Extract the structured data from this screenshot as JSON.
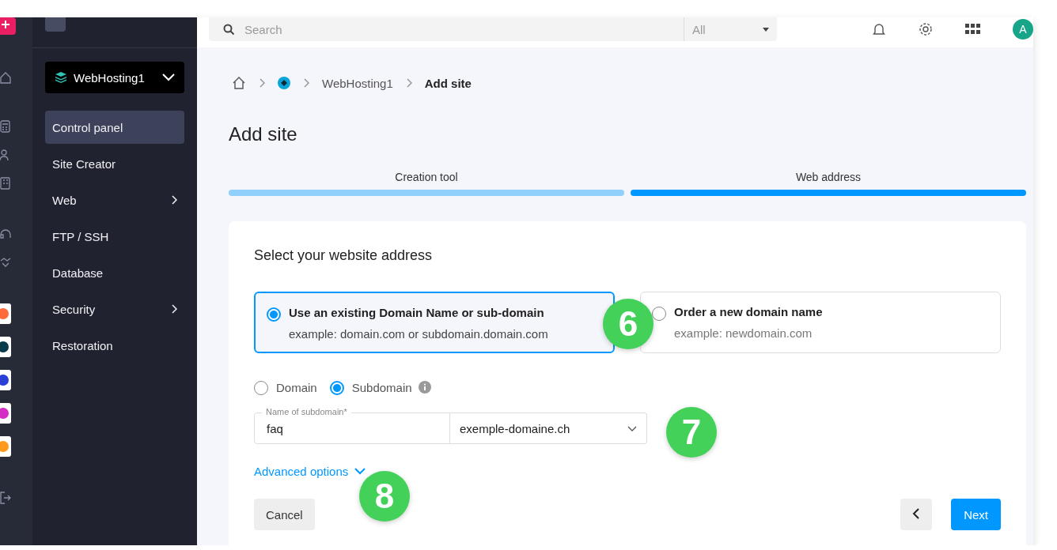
{
  "sidebar": {
    "product": {
      "name": "WebHosting1"
    },
    "items": [
      {
        "label": "Control panel",
        "selected": true,
        "expandable": false
      },
      {
        "label": "Site Creator",
        "selected": false,
        "expandable": false
      },
      {
        "label": "Web",
        "selected": false,
        "expandable": true
      },
      {
        "label": "FTP / SSH",
        "selected": false,
        "expandable": false
      },
      {
        "label": "Database",
        "selected": false,
        "expandable": false
      },
      {
        "label": "Security",
        "selected": false,
        "expandable": true
      },
      {
        "label": "Restoration",
        "selected": false,
        "expandable": false
      }
    ]
  },
  "topbar": {
    "search": {
      "placeholder": "Search"
    },
    "filter": {
      "value": "All"
    },
    "avatar": {
      "initial": "A"
    }
  },
  "breadcrumb": [
    {
      "kind": "home"
    },
    {
      "kind": "logo"
    },
    {
      "kind": "link",
      "label": "WebHosting1"
    },
    {
      "kind": "current",
      "label": "Add site"
    }
  ],
  "title": "Add site",
  "steps": [
    {
      "label": "Creation tool",
      "selected": false
    },
    {
      "label": "Web address",
      "selected": true
    }
  ],
  "form": {
    "heading": "Select your website address",
    "options": [
      {
        "title": "Use an existing Domain Name or sub-domain",
        "example": "example: domain.com or subdomain.domain.com",
        "selected": true
      },
      {
        "title": "Order a new domain name",
        "example": "example: newdomain.com",
        "selected": false
      }
    ],
    "types": [
      {
        "label": "Domain",
        "selected": false
      },
      {
        "label": "Subdomain",
        "selected": true
      }
    ],
    "subdomain_field": {
      "label": "Name of subdomain*",
      "value": "faq"
    },
    "domain_select": {
      "value": "exemple-domaine.ch"
    },
    "advanced_link": "Advanced options",
    "buttons": {
      "cancel": "Cancel",
      "next": "Next"
    }
  },
  "annotations": [
    "6",
    "7",
    "8"
  ]
}
